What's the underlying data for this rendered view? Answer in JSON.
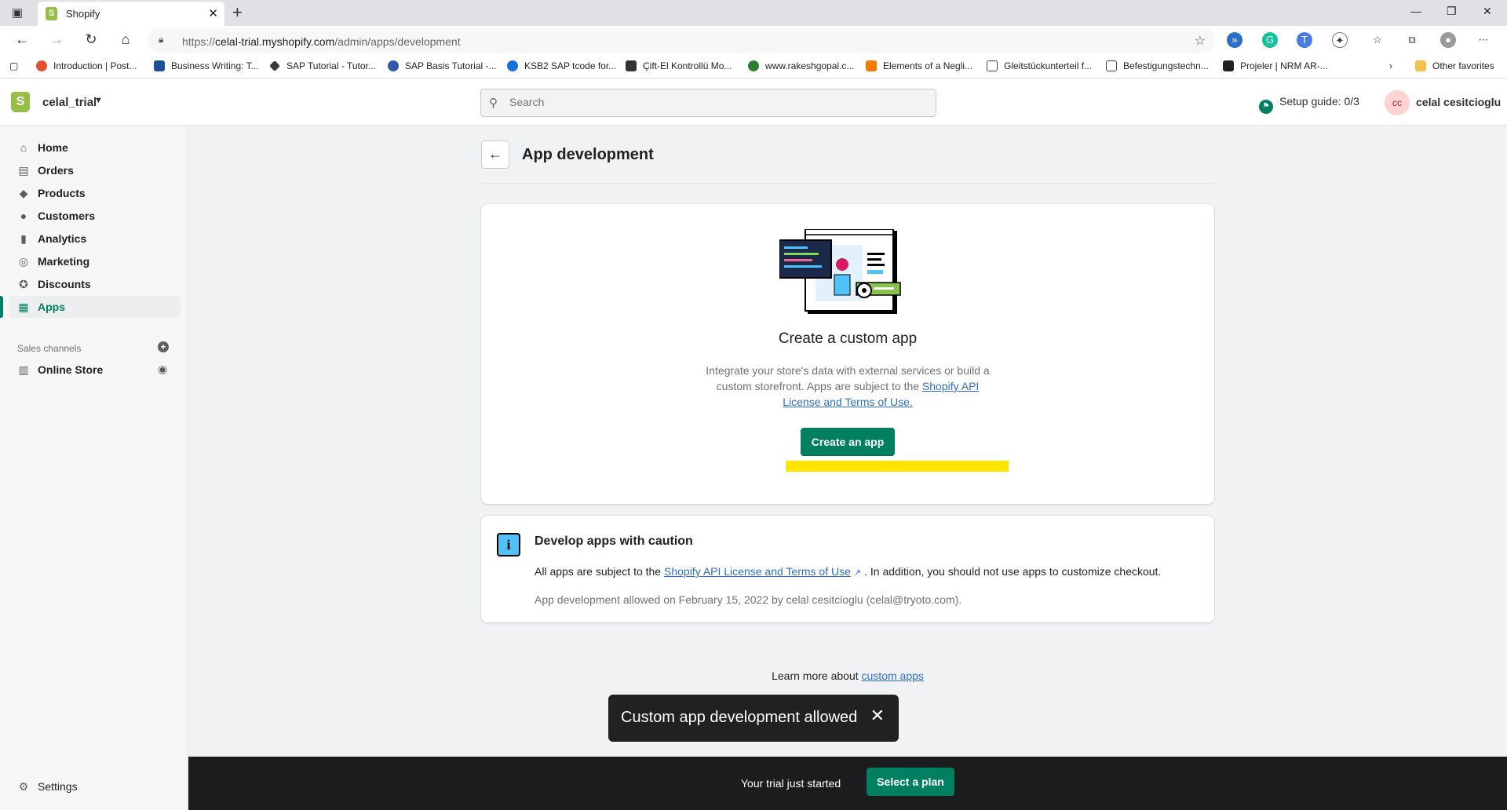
{
  "browser": {
    "tab_title": "Shopify",
    "url_prefix": "https://",
    "url_host": "celal-trial.myshopify.com",
    "url_path": "/admin/apps/development",
    "bookmarks": [
      {
        "label": "Introduction | Post...",
        "color": "#e2542f"
      },
      {
        "label": "Business Writing: T...",
        "color": "#1f4e9a"
      },
      {
        "label": "SAP Tutorial - Tutor...",
        "color": "#3a3a3a"
      },
      {
        "label": "SAP Basis Tutorial -...",
        "color": "#3557a8"
      },
      {
        "label": "KSB2 SAP tcode for...",
        "color": "#1a6fd8"
      },
      {
        "label": "Çift-El Kontrollü Mo...",
        "color": "#333333"
      },
      {
        "label": "www.rakeshgopal.c...",
        "color": "#2e7d32"
      },
      {
        "label": "Elements of a Negli...",
        "color": "#f57c00"
      },
      {
        "label": "Gleitstückunterteil f...",
        "color": "#ffffff"
      },
      {
        "label": "Befestigungstechn...",
        "color": "#ffffff"
      },
      {
        "label": "Projeler | NRM AR-...",
        "color": "#222222"
      }
    ],
    "other_favorites": "Other favorites"
  },
  "topbar": {
    "store_name": "celal_trial",
    "search_placeholder": "Search",
    "setup_guide": "Setup guide: 0/3",
    "avatar_initials": "cc",
    "user_name": "celal cesitcioglu"
  },
  "sidebar": {
    "items": [
      {
        "label": "Home",
        "icon": "home-icon"
      },
      {
        "label": "Orders",
        "icon": "orders-icon"
      },
      {
        "label": "Products",
        "icon": "tag-icon"
      },
      {
        "label": "Customers",
        "icon": "person-icon"
      },
      {
        "label": "Analytics",
        "icon": "bar-chart-icon"
      },
      {
        "label": "Marketing",
        "icon": "target-icon"
      },
      {
        "label": "Discounts",
        "icon": "discount-icon"
      },
      {
        "label": "Apps",
        "icon": "apps-icon"
      }
    ],
    "sales_channels_title": "Sales channels",
    "online_store": "Online Store",
    "settings": "Settings"
  },
  "main": {
    "page_title": "App development",
    "create_card": {
      "title": "Create a custom app",
      "desc_part1": "Integrate your store's data with external services or build a custom storefront. Apps are subject to the ",
      "desc_link": "Shopify API License and Terms of Use.",
      "button": "Create an app"
    },
    "caution_card": {
      "title": "Develop apps with caution",
      "body_part1": "All apps are subject to the ",
      "body_link": "Shopify API License and Terms of Use",
      "body_part2": ". In addition, you should not use apps to customize checkout.",
      "note": "App development allowed on February 15, 2022 by celal cesitcioglu (celal@tryoto.com)."
    },
    "learn_more": "Learn more about ",
    "learn_more_link": "custom apps",
    "toast": "Custom app development allowed",
    "trial_text": "Your trial just started",
    "plan_button": "Select a plan"
  },
  "colors": {
    "primary": "#008060",
    "link": "#2c6ecb",
    "highlight": "#ffe600"
  }
}
